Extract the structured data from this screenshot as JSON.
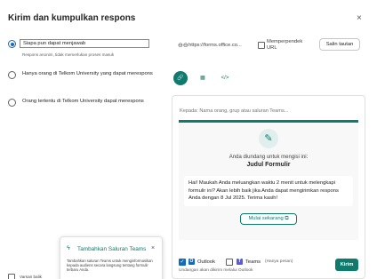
{
  "dialog": {
    "title": "Kirim dan kumpulkan respons",
    "close_glyph": "×"
  },
  "options": {
    "anyone": "Siapa pun dapat menjawab",
    "anyone_hint": "Respons anonim, tidak memerlukan proses masuk",
    "org": "Hanya orang di Telkom University yang dapat merespons",
    "specific": "Orang tertentu di Telkom University dapat merespons"
  },
  "link": {
    "icon_glyph": "⊖⊖",
    "url": "https://forms.office.co...",
    "shorten_label_line1": "Memperpendek",
    "shorten_label_line2": "URL",
    "copy_label": "Salin tautan"
  },
  "tabs": {
    "link_icon": "🔗",
    "qr_icon": "▦",
    "embed_icon": "</>"
  },
  "preview": {
    "search_placeholder": "Kepada: Nama orang, grup atau saluran Teams...",
    "invite_text": "Anda diundang untuk mengisi ini:",
    "form_title": "Judul Formulir",
    "message": "Hai! Maukah Anda meluangkan waktu 2 menit untuk melengkapi formulir ini? Akan lebih baik jika Anda dapat mengirimkan respons Anda dengan 8 Jul 2025. Terima kasih!",
    "start_label": "Mulai sekarang",
    "start_icon": "⧉"
  },
  "footer": {
    "outlook_label": "Outlook",
    "teams_label": "Teams",
    "teams_hint": "(Hanya pesan)",
    "note": "Undangan akan dikirim melalui Outlook",
    "send_label": "Kirim",
    "check_glyph": "✓",
    "outlook_glyph": "O",
    "teams_glyph": "T"
  },
  "popup": {
    "icon_glyph": "ϟ",
    "title": "Tambahkan Saluran Teams",
    "close_glyph": "×",
    "body": "Tambahkan saluran Teams untuk menginformasikan kepada audiens secara langsung tentang formulir terbaru Anda."
  },
  "bottom_left": {
    "label": "Varsan balik"
  },
  "colors": {
    "accent": "#0f7b6c",
    "selection": "#0f6cbd"
  }
}
